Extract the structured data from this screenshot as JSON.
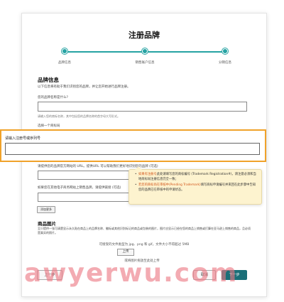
{
  "title": "注册品牌",
  "steps": [
    {
      "label": "品牌信息"
    },
    {
      "label": "销售账户信息"
    },
    {
      "label": "分销信息"
    }
  ],
  "section": {
    "heading": "品牌信息",
    "intro": "以下信息将有助于我们识别您的品牌，并让您开始进行品牌注册。"
  },
  "brand_name": {
    "label": "您的品牌名称是什么?",
    "hint": "请输入您的商标名称，其中包括您的品牌名称的首字母大写形式。"
  },
  "trademark_office": {
    "label": "选择一个商标局"
  },
  "registration": {
    "label": "请输入注册号或序列号"
  },
  "website": {
    "label": "请提供您的品牌官方网站的 URL。提供URL 可以帮助我们更好地识别您的品牌 (可选)"
  },
  "tooltip": {
    "items": [
      {
        "term": "如果有注册号",
        "text": "此处请填写您的商标编号 (Trademark Registration#)，请注意必须和当地商标局注册信息完全一致；"
      },
      {
        "term": "若您的商标尚在审核中(Pending Trademark)",
        "text": "填写商标申请编号并来回在此步骤中告知您的品牌已在审核中的申请状态。"
      }
    ]
  },
  "ecommerce": {
    "label": "如果您在其他电子商务网站上销售品牌，请提供链接 (可选)",
    "add_button": "添加更多"
  },
  "images": {
    "heading": "商品图片",
    "description": "至少提供一张可清楚显示永久贴在商品上的品牌名称、徽标或其他识别标记的商品或包装的图片，图片应显示已经在您的商品上销售或打算在亚马逊上销售的商品，且必须是真实的照片。",
    "formats": "可接受的文件类型为 jpg、png 和 gif。文件大小不得超过 5MB",
    "upload_button": "上传",
    "drop_hint": "或将图片拖放至此处上传"
  },
  "footer": {
    "prev_button": "上一步",
    "cancel_button": "取消",
    "next_button": "下一步"
  },
  "watermark": "awyerwu.com",
  "colors": {
    "accent": "#26a3a3",
    "highlight_border": "#f0a22a",
    "tooltip_bg": "#fdf3cf",
    "primary_button": "#1b6f78"
  }
}
